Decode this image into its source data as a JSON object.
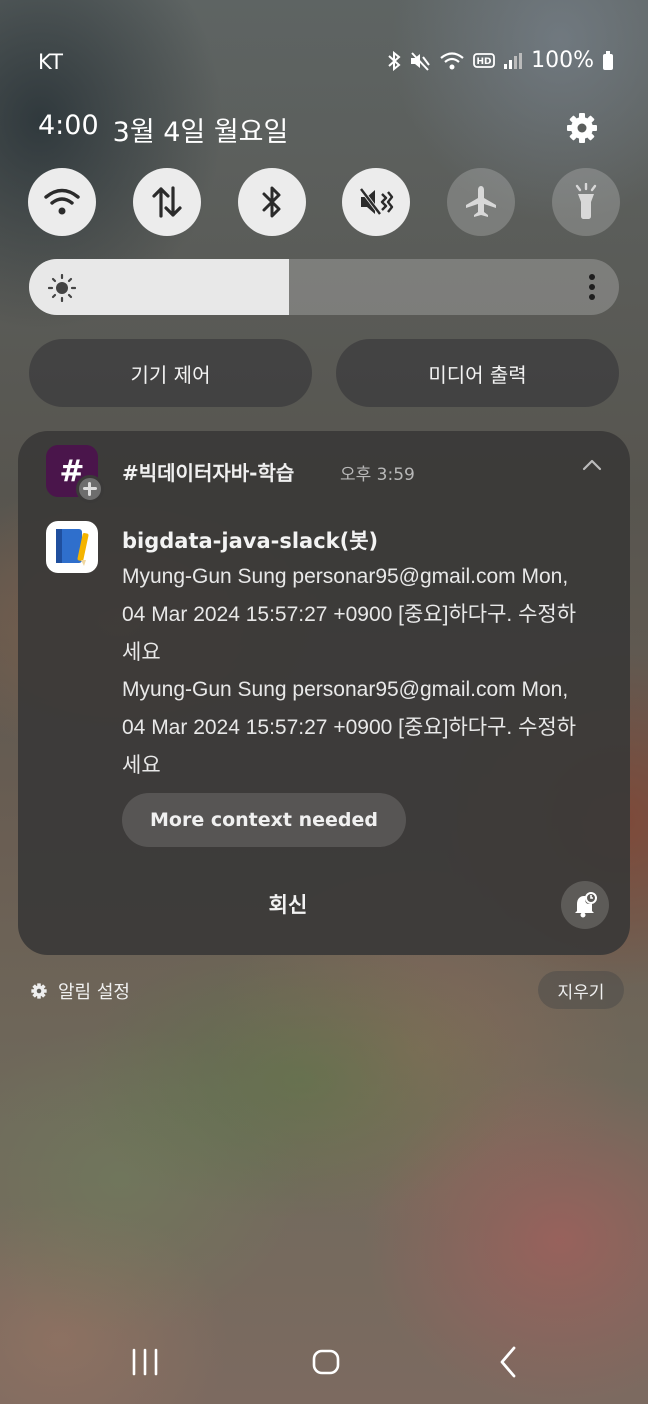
{
  "status_bar": {
    "carrier": "KT",
    "battery": "100%"
  },
  "header": {
    "time": "4:00",
    "date": "3월 4일 월요일"
  },
  "quick_settings": {
    "toggles": [
      {
        "icon": "wifi-icon",
        "state": "on"
      },
      {
        "icon": "mobile-data-icon",
        "state": "on"
      },
      {
        "icon": "bluetooth-icon",
        "state": "on"
      },
      {
        "icon": "mute-icon",
        "state": "on"
      },
      {
        "icon": "airplane-icon",
        "state": "off"
      },
      {
        "icon": "flashlight-icon",
        "state": "off"
      }
    ],
    "brightness_level": 0.44,
    "device_control_label": "기기 제어",
    "media_output_label": "미디어 출력"
  },
  "notification": {
    "app_icon": "slack-icon",
    "channel": "#빅데이터자바-학습",
    "time": "오후 3:59",
    "sender": "bigdata-java-slack(봇)",
    "messages": [
      "Myung-Gun Sung personar95@gmail.com Mon, 04 Mar 2024 15:57:27 +0900 [중요]하다구. 수정하세요",
      "Myung-Gun Sung personar95@gmail.com Mon, 04 Mar 2024 15:57:27 +0900 [중요]하다구. 수정하세요"
    ],
    "suggestion": "More context needed",
    "reply_label": "회신",
    "accent": "#4a154b"
  },
  "footer": {
    "notification_settings_label": "알림 설정",
    "clear_label": "지우기"
  }
}
